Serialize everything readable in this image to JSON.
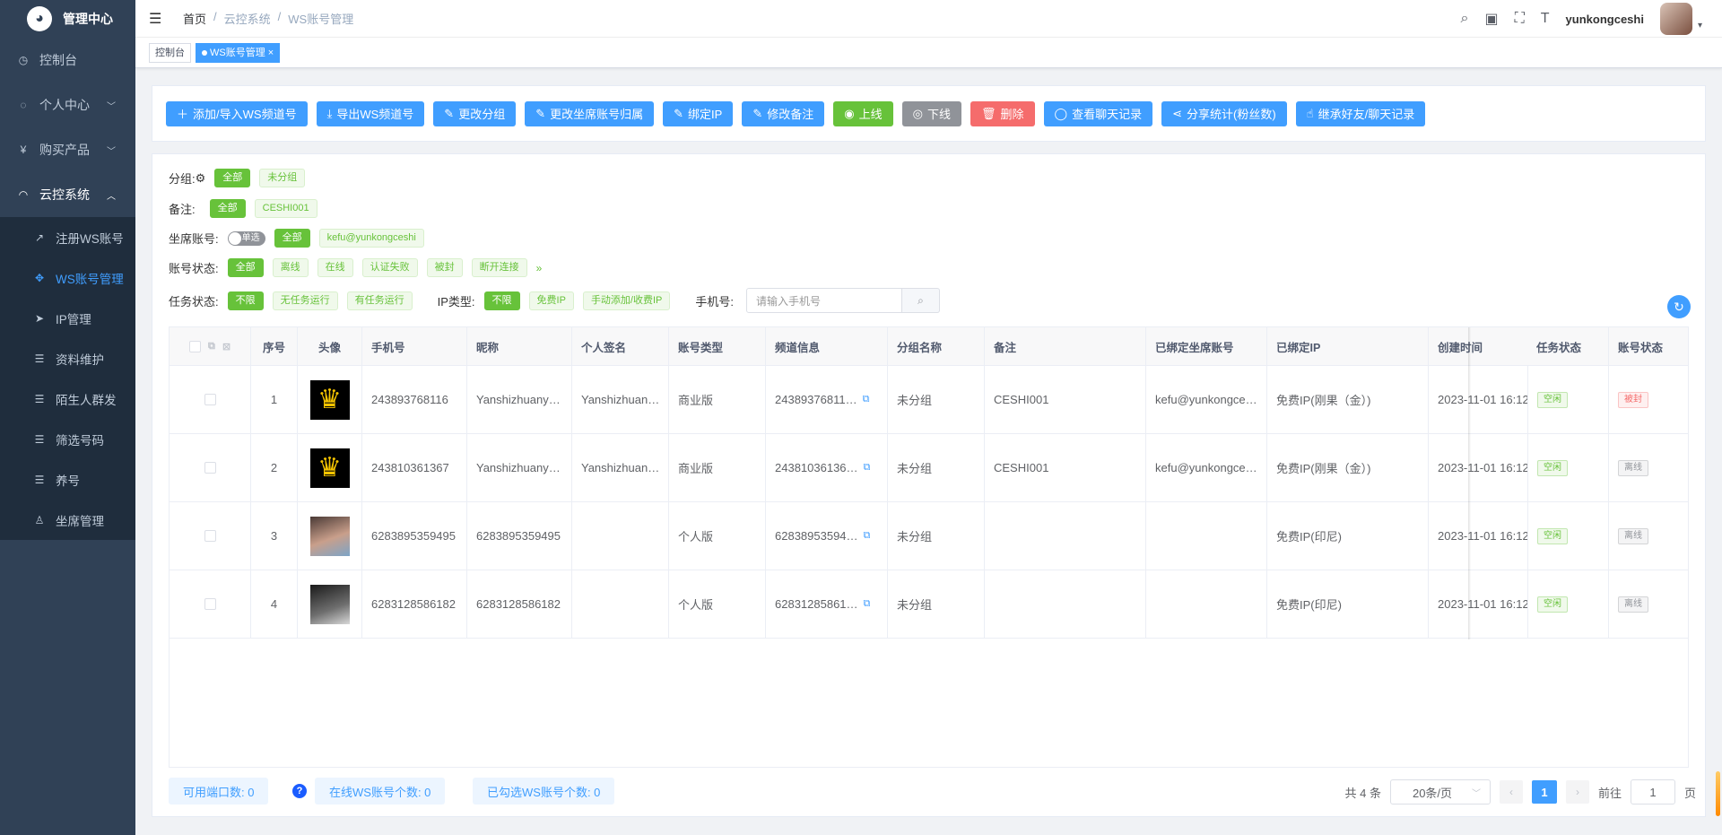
{
  "sidebar": {
    "title": "管理中心",
    "items": [
      {
        "label": "控制台",
        "icon": "dashboard-icon"
      },
      {
        "label": "个人中心",
        "icon": "user-icon"
      },
      {
        "label": "购买产品",
        "icon": "yen-icon"
      },
      {
        "label": "云控系统",
        "icon": "headset-icon"
      }
    ],
    "subitems": [
      {
        "label": "注册WS账号"
      },
      {
        "label": "WS账号管理"
      },
      {
        "label": "IP管理"
      },
      {
        "label": "资料维护"
      },
      {
        "label": "陌生人群发"
      },
      {
        "label": "筛选号码"
      },
      {
        "label": "养号"
      },
      {
        "label": "坐席管理"
      }
    ]
  },
  "header": {
    "breadcrumb": [
      "首页",
      "/",
      "云控系统",
      "/",
      "WS账号管理"
    ],
    "username": "yunkongceshi"
  },
  "tags": [
    "控制台",
    "WS账号管理"
  ],
  "toolbar": {
    "buttons": [
      "添加/导入WS频道号",
      "导出WS频道号",
      "更改分组",
      "更改坐席账号归属",
      "绑定IP",
      "修改备注",
      "上线",
      "下线",
      "删除",
      "查看聊天记录",
      "分享统计(粉丝数)",
      "继承好友/聊天记录"
    ]
  },
  "filters": {
    "group_label": "分组:",
    "group_chips": [
      "全部",
      "未分组"
    ],
    "remark_label": "备注:",
    "remark_chips": [
      "全部",
      "CESHI001"
    ],
    "seat_label": "坐席账号:",
    "seat_switch": "单选",
    "seat_chips": [
      "全部",
      "kefu@yunkongceshi"
    ],
    "status_label": "账号状态:",
    "status_chips": [
      "全部",
      "离线",
      "在线",
      "认证失败",
      "被封",
      "断开连接"
    ],
    "task_label": "任务状态:",
    "task_chips": [
      "不限",
      "无任务运行",
      "有任务运行"
    ],
    "ip_label": "IP类型:",
    "ip_chips": [
      "不限",
      "免费IP",
      "手动添加/收费IP"
    ],
    "phone_label": "手机号:",
    "phone_placeholder": "请输入手机号"
  },
  "table": {
    "columns": [
      "序号",
      "头像",
      "手机号",
      "昵称",
      "个人签名",
      "账号类型",
      "频道信息",
      "分组名称",
      "备注",
      "已绑定坐席账号",
      "已绑定IP",
      "创建时间",
      "任务状态",
      "账号状态"
    ],
    "rows": [
      {
        "no": "1",
        "avatar": "crown",
        "phone": "243893768116",
        "nick": "Yanshizhuany…",
        "sign": "Yanshizhuan…",
        "type": "商业版",
        "channel": "24389376811…",
        "group": "未分组",
        "remark": "CESHI001",
        "seat": "kefu@yunkongce…",
        "ip": "免费IP(刚果（金）)",
        "created": "2023-11-01 16:12",
        "task": "空闲",
        "status": "被封",
        "status_kind": "red"
      },
      {
        "no": "2",
        "avatar": "crown",
        "phone": "243810361367",
        "nick": "Yanshizhuany…",
        "sign": "Yanshizhuan…",
        "type": "商业版",
        "channel": "24381036136…",
        "group": "未分组",
        "remark": "CESHI001",
        "seat": "kefu@yunkongce…",
        "ip": "免费IP(刚果（金）)",
        "created": "2023-11-01 16:12",
        "task": "空闲",
        "status": "离线",
        "status_kind": "gray"
      },
      {
        "no": "3",
        "avatar": "girl1",
        "phone": "6283895359495",
        "nick": "6283895359495",
        "sign": "",
        "type": "个人版",
        "channel": "62838953594…",
        "group": "未分组",
        "remark": "",
        "seat": "",
        "ip": "免费IP(印尼)",
        "created": "2023-11-01 16:12",
        "task": "空闲",
        "status": "离线",
        "status_kind": "gray"
      },
      {
        "no": "4",
        "avatar": "girl2",
        "phone": "6283128586182",
        "nick": "6283128586182",
        "sign": "",
        "type": "个人版",
        "channel": "62831285861…",
        "group": "未分组",
        "remark": "",
        "seat": "",
        "ip": "免费IP(印尼)",
        "created": "2023-11-01 16:12",
        "task": "空闲",
        "status": "离线",
        "status_kind": "gray"
      }
    ]
  },
  "footer": {
    "available_ports": "可用端口数:  0",
    "online_count": "在线WS账号个数:  0",
    "selected_count": "已勾选WS账号个数:  0",
    "total": "共 4 条",
    "page_size": "20条/页",
    "current_page": "1",
    "goto_label": "前往",
    "goto_value": "1",
    "page_suffix": "页"
  },
  "colors": {
    "primary": "#409eff",
    "success": "#67c23a",
    "danger": "#f56c6c",
    "sidebar": "#304156"
  }
}
